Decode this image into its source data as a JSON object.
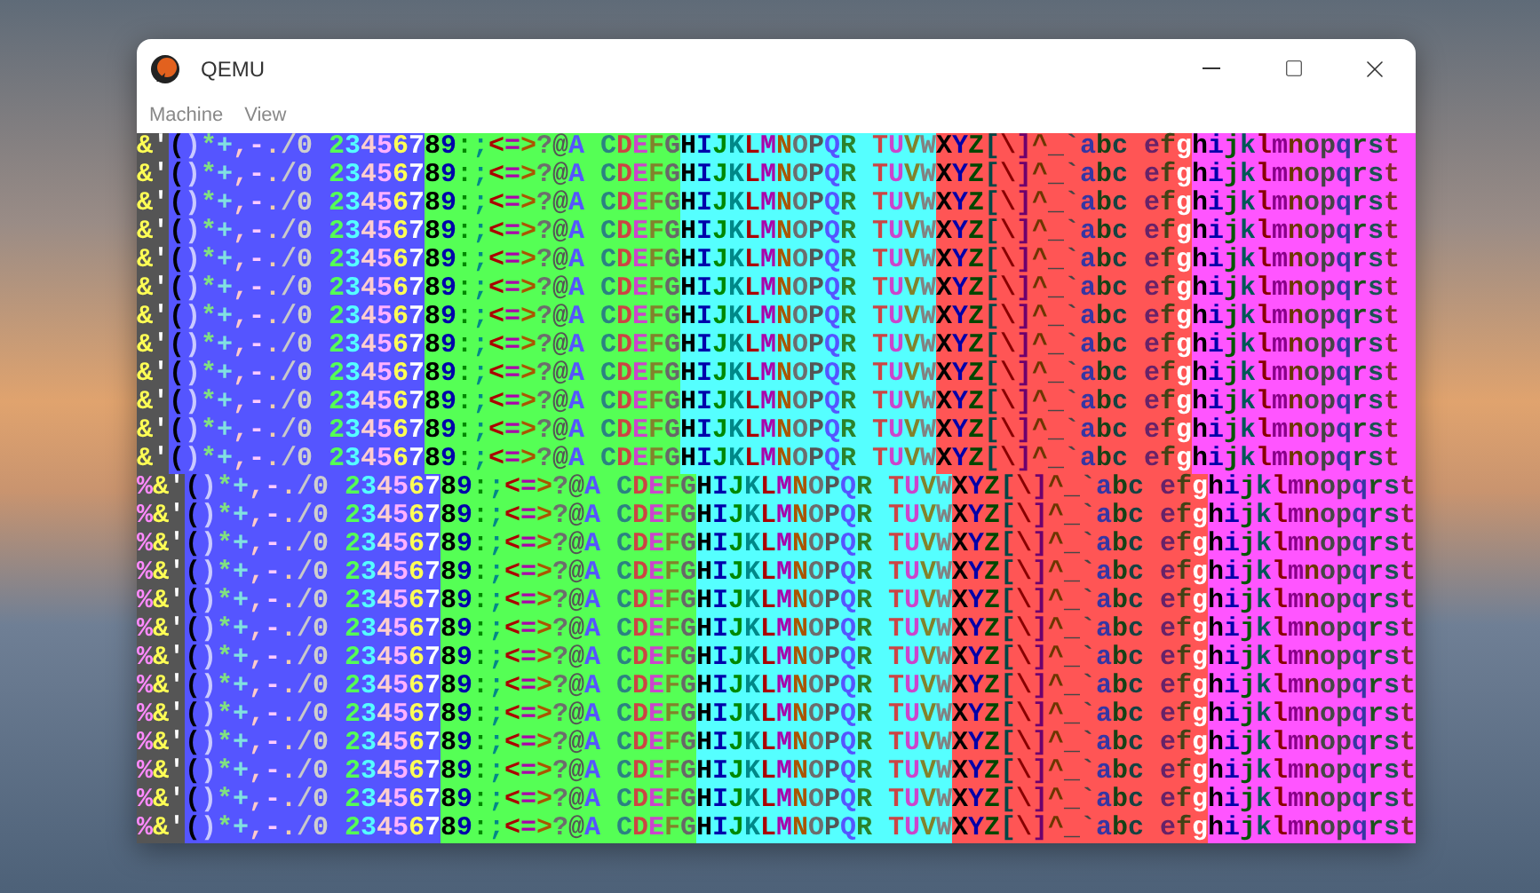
{
  "window": {
    "title": "QEMU"
  },
  "menu": [
    "Machine",
    "View"
  ],
  "screen": {
    "rows": [
      {
        "kind": "start",
        "text": "&'()*+,-./0 23456789:;<=>?@A CDEFGHIJKLMNOPQR TUVWXYZ[\\]^_`abc efghijklmnopqrst"
      },
      {
        "kind": "start",
        "text": "&'()*+,-./0 23456789:;<=>?@A CDEFGHIJKLMNOPQR TUVWXYZ[\\]^_`abc efghijklmnopqrst"
      },
      {
        "kind": "start",
        "text": "&'()*+,-./0 23456789:;<=>?@A CDEFGHIJKLMNOPQR TUVWXYZ[\\]^_`abc efghijklmnopqrst"
      },
      {
        "kind": "start",
        "text": "&'()*+,-./0 23456789:;<=>?@A CDEFGHIJKLMNOPQR TUVWXYZ[\\]^_`abc efghijklmnopqrst"
      },
      {
        "kind": "start",
        "text": "&'()*+,-./0 23456789:;<=>?@A CDEFGHIJKLMNOPQR TUVWXYZ[\\]^_`abc efghijklmnopqrst"
      },
      {
        "kind": "start",
        "text": "&'()*+,-./0 23456789:;<=>?@A CDEFGHIJKLMNOPQR TUVWXYZ[\\]^_`abc efghijklmnopqrst"
      },
      {
        "kind": "start",
        "text": "&'()*+,-./0 23456789:;<=>?@A CDEFGHIJKLMNOPQR TUVWXYZ[\\]^_`abc efghijklmnopqrst"
      },
      {
        "kind": "start",
        "text": "&'()*+,-./0 23456789:;<=>?@A CDEFGHIJKLMNOPQR TUVWXYZ[\\]^_`abc efghijklmnopqrst"
      },
      {
        "kind": "start",
        "text": "&'()*+,-./0 23456789:;<=>?@A CDEFGHIJKLMNOPQR TUVWXYZ[\\]^_`abc efghijklmnopqrst"
      },
      {
        "kind": "start",
        "text": "&'()*+,-./0 23456789:;<=>?@A CDEFGHIJKLMNOPQR TUVWXYZ[\\]^_`abc efghijklmnopqrst"
      },
      {
        "kind": "start",
        "text": "&'()*+,-./0 23456789:;<=>?@A CDEFGHIJKLMNOPQR TUVWXYZ[\\]^_`abc efghijklmnopqrst"
      },
      {
        "kind": "start",
        "text": "&'()*+,-./0 23456789:;<=>?@A CDEFGHIJKLMNOPQR TUVWXYZ[\\]^_`abc efghijklmnopqrst"
      },
      {
        "kind": "shifted",
        "text": "%&'()*+,-./0 23456789:;<=>?@A CDEFGHIJKLMNOPQR TUVWXYZ[\\]^_`abc efghijklmnopqrst"
      },
      {
        "kind": "shifted",
        "text": "%&'()*+,-./0 23456789:;<=>?@A CDEFGHIJKLMNOPQR TUVWXYZ[\\]^_`abc efghijklmnopqrst"
      },
      {
        "kind": "shifted",
        "text": "%&'()*+,-./0 23456789:;<=>?@A CDEFGHIJKLMNOPQR TUVWXYZ[\\]^_`abc efghijklmnopqrst"
      },
      {
        "kind": "shifted",
        "text": "%&'()*+,-./0 23456789:;<=>?@A CDEFGHIJKLMNOPQR TUVWXYZ[\\]^_`abc efghijklmnopqrst"
      },
      {
        "kind": "shifted",
        "text": "%&'()*+,-./0 23456789:;<=>?@A CDEFGHIJKLMNOPQR TUVWXYZ[\\]^_`abc efghijklmnopqrst"
      },
      {
        "kind": "shifted",
        "text": "%&'()*+,-./0 23456789:;<=>?@A CDEFGHIJKLMNOPQR TUVWXYZ[\\]^_`abc efghijklmnopqrst"
      },
      {
        "kind": "shifted",
        "text": "%&'()*+,-./0 23456789:;<=>?@A CDEFGHIJKLMNOPQR TUVWXYZ[\\]^_`abc efghijklmnopqrst"
      },
      {
        "kind": "shifted",
        "text": "%&'()*+,-./0 23456789:;<=>?@A CDEFGHIJKLMNOPQR TUVWXYZ[\\]^_`abc efghijklmnopqrst"
      },
      {
        "kind": "shifted",
        "text": "%&'()*+,-./0 23456789:;<=>?@A CDEFGHIJKLMNOPQR TUVWXYZ[\\]^_`abc efghijklmnopqrst"
      },
      {
        "kind": "shifted",
        "text": "%&'()*+,-./0 23456789:;<=>?@A CDEFGHIJKLMNOPQR TUVWXYZ[\\]^_`abc efghijklmnopqrst"
      },
      {
        "kind": "shifted",
        "text": "%&'()*+,-./0 23456789:;<=>?@A CDEFGHIJKLMNOPQR TUVWXYZ[\\]^_`abc efghijklmnopqrst"
      },
      {
        "kind": "shifted",
        "text": "%&'()*+,-./0 23456789:;<=>?@A CDEFGHIJKLMNOPQR TUVWXYZ[\\]^_`abc efghijklmnopqrst"
      },
      {
        "kind": "shifted",
        "text": "%&'()*+,-./0 23456789:;<=>?@A CDEFGHIJKLMNOPQR TUVWXYZ[\\]^_`abc efghijklmnopqrst"
      }
    ]
  }
}
